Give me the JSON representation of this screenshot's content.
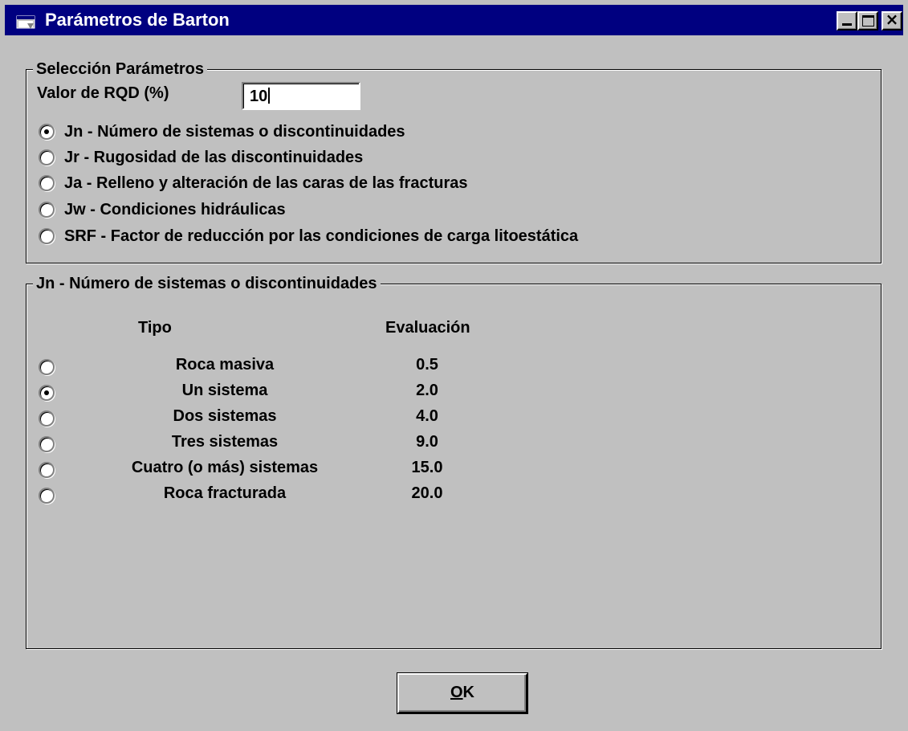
{
  "window": {
    "title": "Parámetros de Barton",
    "app_icon": "window-app-icon"
  },
  "selection": {
    "legend": "Selección Parámetros",
    "rqd_label": "Valor de RQD (%)",
    "rqd_value": "10",
    "options": [
      {
        "label": "Jn - Número de sistemas o discontinuidades",
        "checked": true
      },
      {
        "label": "Jr - Rugosidad de las discontinuidades",
        "checked": false
      },
      {
        "label": "Ja - Relleno y alteración de las caras de las fracturas",
        "checked": false
      },
      {
        "label": "Jw - Condiciones hidráulicas",
        "checked": false
      },
      {
        "label": "SRF - Factor de reducción por las condiciones de carga litoestática",
        "checked": false
      }
    ]
  },
  "detail": {
    "legend": "Jn - Número de sistemas o discontinuidades",
    "col_tipo": "Tipo",
    "col_evaluacion": "Evaluación",
    "rows": [
      {
        "tipo": "Roca masiva",
        "evaluacion": "0.5",
        "checked": false
      },
      {
        "tipo": "Un sistema",
        "evaluacion": "2.0",
        "checked": true
      },
      {
        "tipo": "Dos sistemas",
        "evaluacion": "4.0",
        "checked": false
      },
      {
        "tipo": "Tres sistemas",
        "evaluacion": "9.0",
        "checked": false
      },
      {
        "tipo": "Cuatro (o más) sistemas",
        "evaluacion": "15.0",
        "checked": false
      },
      {
        "tipo": "Roca fracturada",
        "evaluacion": "20.0",
        "checked": false
      }
    ]
  },
  "buttons": {
    "ok_mnemonic": "O",
    "ok_rest": "K"
  },
  "colors": {
    "titlebar": "#000080",
    "face": "#c0c0c0"
  }
}
